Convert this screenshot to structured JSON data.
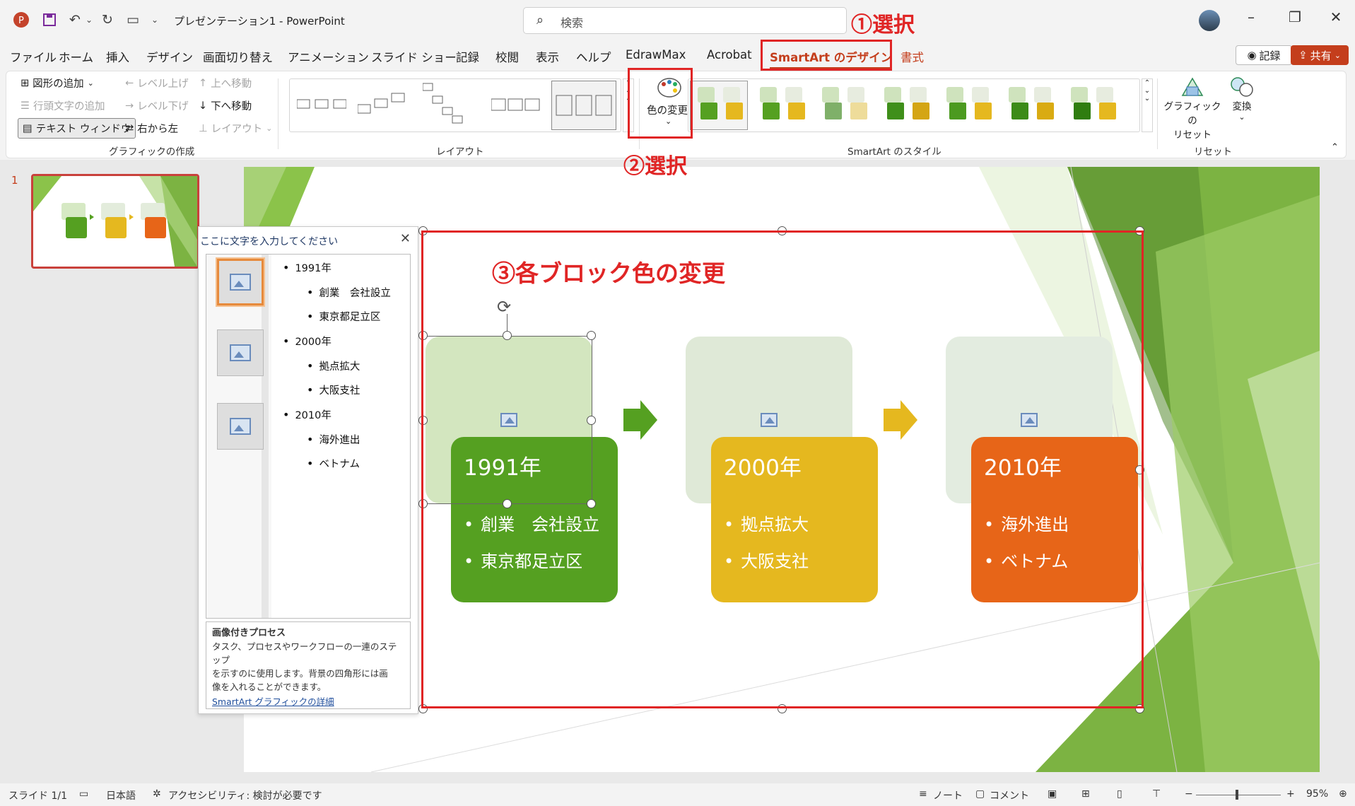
{
  "titlebar": {
    "doc_title": "プレゼンテーション1",
    "app_name": "PowerPoint",
    "search_placeholder": "検索"
  },
  "tabs": [
    "ファイル",
    "ホーム",
    "挿入",
    "デザイン",
    "画面切り替え",
    "アニメーション",
    "スライド ショー",
    "記録",
    "校閲",
    "表示",
    "ヘルプ",
    "EdrawMax",
    "Acrobat",
    "SmartArt のデザイン",
    "書式"
  ],
  "tab_right": {
    "record": "記録",
    "share": "共有"
  },
  "ribbon": {
    "create": {
      "add_shape": "図形の追加",
      "add_bullet": "行頭文字の追加",
      "text_pane": "テキスト ウィンドウ",
      "promote": "レベル上げ",
      "demote": "レベル下げ",
      "rtl": "右から左",
      "move_up": "上へ移動",
      "move_down": "下へ移動",
      "layout": "レイアウト",
      "group_label": "グラフィックの作成"
    },
    "layouts_label": "レイアウト",
    "change_colors": "色の変更",
    "styles_label": "SmartArt のスタイル",
    "reset": {
      "reset_graphic": "グラフィックの",
      "reset_graphic2": "リセット",
      "convert": "変換",
      "group_label": "リセット"
    }
  },
  "annotations": {
    "a1": "①選択",
    "a2": "②選択",
    "a3": "③各ブロック色の変更"
  },
  "thumbnail": {
    "slide_number": "1"
  },
  "text_pane": {
    "header": "ここに文字を入力してください",
    "items": [
      {
        "level": 1,
        "text": "1991年"
      },
      {
        "level": 2,
        "text": "創業　会社設立"
      },
      {
        "level": 2,
        "text": "東京都足立区"
      },
      {
        "level": 1,
        "text": "2000年"
      },
      {
        "level": 2,
        "text": "拠点拡大"
      },
      {
        "level": 2,
        "text": "大阪支社"
      },
      {
        "level": 1,
        "text": "2010年"
      },
      {
        "level": 2,
        "text": "海外進出"
      },
      {
        "level": 2,
        "text": "ベトナム"
      }
    ],
    "info_title": "画像付きプロセス",
    "info_desc1": "タスク、プロセスやワークフローの一連のステップ",
    "info_desc2": "を示すのに使用します。背景の四角形には画",
    "info_desc3": "像を入れることができます。",
    "info_link": "SmartArt グラフィックの詳細"
  },
  "smartart": {
    "blocks": [
      {
        "year": "1991年",
        "items": [
          "創業　会社設立",
          "東京都足立区"
        ],
        "color": "#55a021"
      },
      {
        "year": "2000年",
        "items": [
          "拠点拡大",
          "大阪支社"
        ],
        "color": "#e5b81f"
      },
      {
        "year": "2010年",
        "items": [
          "海外進出",
          "ベトナム"
        ],
        "color": "#e76518"
      }
    ],
    "arrow_colors": [
      "#55a021",
      "#e5b81f"
    ]
  },
  "statusbar": {
    "slide": "スライド 1/1",
    "language": "日本語",
    "accessibility": "アクセシビリティ: 検討が必要です",
    "notes": "ノート",
    "comments": "コメント",
    "zoom": "95%"
  },
  "colors": {
    "accent": "#c43e1c",
    "annotation_red": "#e02525",
    "theme_green": "#8bc34a"
  }
}
